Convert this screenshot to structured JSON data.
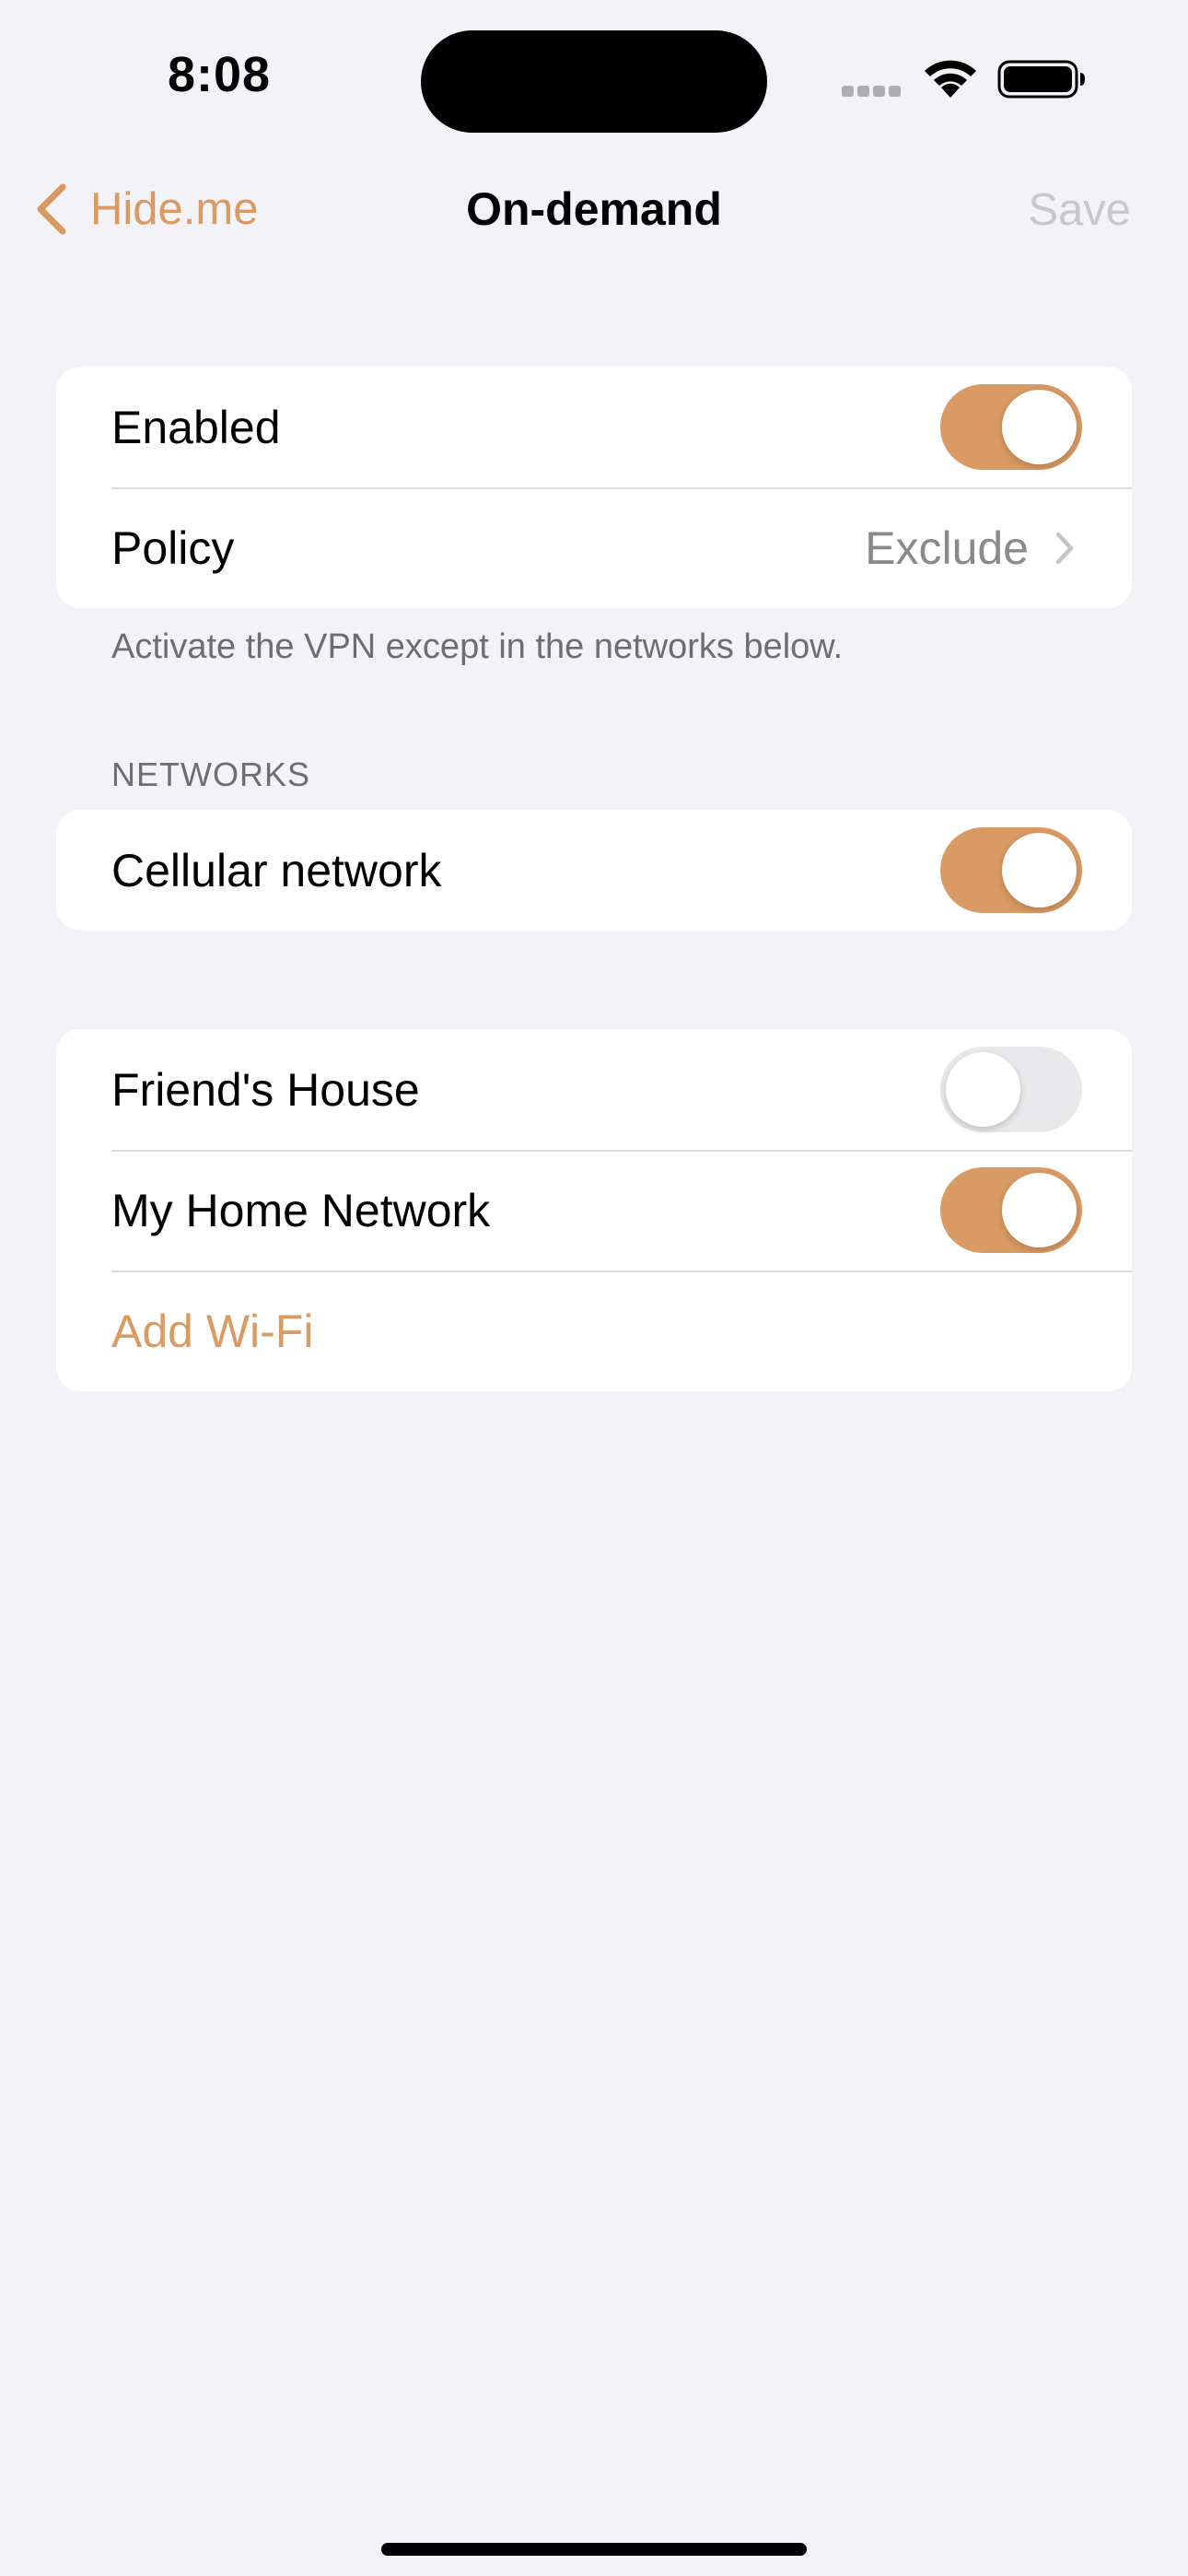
{
  "status_bar": {
    "time": "8:08"
  },
  "nav": {
    "back_label": "Hide.me",
    "title": "On-demand",
    "save_label": "Save"
  },
  "settings": {
    "enabled_label": "Enabled",
    "enabled_on": true,
    "policy_label": "Policy",
    "policy_value": "Exclude",
    "policy_footer": "Activate the VPN except in the networks below."
  },
  "networks": {
    "header": "NETWORKS",
    "cellular_label": "Cellular network",
    "cellular_on": true
  },
  "wifi": {
    "items": [
      {
        "label": "Friend's House",
        "on": false
      },
      {
        "label": "My Home Network",
        "on": true
      }
    ],
    "add_label": "Add Wi-Fi"
  },
  "colors": {
    "accent": "#d99a63",
    "background": "#f2f2f7",
    "toggle_off": "#e9e9eb"
  }
}
